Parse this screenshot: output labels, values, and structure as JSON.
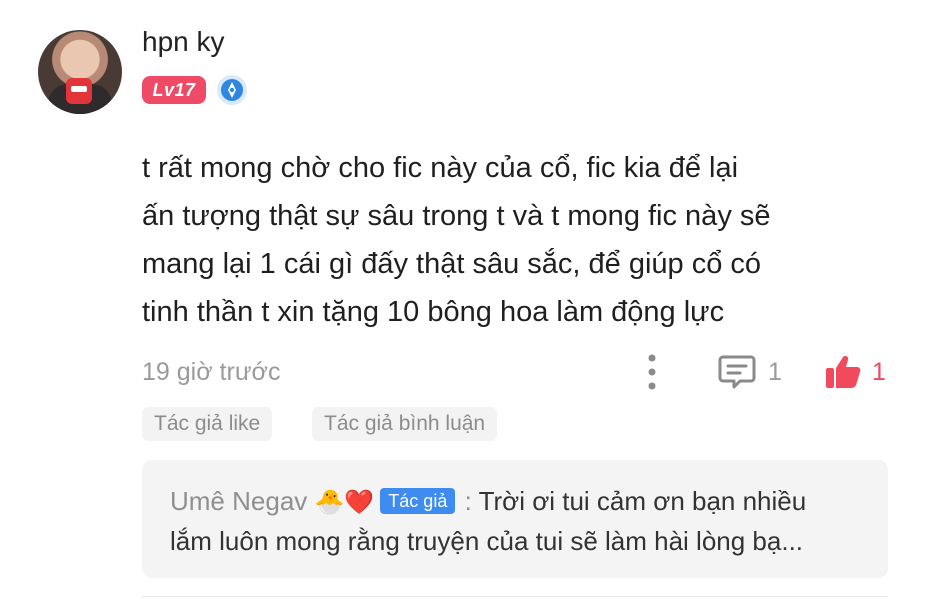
{
  "comment": {
    "username": "hpn ky",
    "level": "Lv17",
    "text_lines": [
      "t rất mong chờ cho fic này của cổ, fic kia để lại",
      "ấn tượng thật sự sâu trong t và t mong fic này sẽ",
      "mang lại 1 cái gì đấy thật sâu sắc, để giúp cổ có",
      "tinh thần t xin tặng 10 bông hoa làm động lực"
    ],
    "timestamp": "19 giờ trước",
    "reply_count": "1",
    "like_count": "1",
    "tags": [
      "Tác giả like",
      "Tác giả bình luận"
    ],
    "icons": {
      "more": "more-vertical-icon",
      "reply": "comment-icon",
      "like": "thumbs-up-icon",
      "verified": "verified-badge-icon"
    }
  },
  "reply": {
    "author": "Umê Negav",
    "emoji_1": "🐣",
    "emoji_2": "❤️",
    "author_badge": "Tác giả",
    "separator": ":",
    "text_line_1": "Trời ơi tui cảm ơn bạn nhiều",
    "text_line_2": "lắm luôn mong rằng truyện của tui sẽ làm hài lòng bạ..."
  },
  "colors": {
    "level_badge": "#ef4a66",
    "like": "#f04a5c",
    "author_badge": "#3f8cf0",
    "verified": "#2e86de"
  }
}
